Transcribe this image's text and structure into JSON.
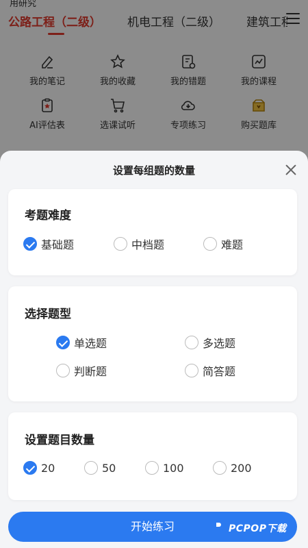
{
  "status_bar": {
    "partial_text": "用研究"
  },
  "top_tabs": [
    {
      "label": "公路工程（二级）",
      "active": true
    },
    {
      "label": "机电工程（二级）",
      "active": false
    },
    {
      "label": "建筑工程",
      "active": false
    }
  ],
  "tools": [
    {
      "label": "我的笔记",
      "icon": "pencil-note-icon"
    },
    {
      "label": "我的收藏",
      "icon": "star-icon"
    },
    {
      "label": "我的错题",
      "icon": "wrong-questions-icon"
    },
    {
      "label": "我的课程",
      "icon": "course-chart-icon"
    },
    {
      "label": "AI评估表",
      "icon": "clipboard-icon"
    },
    {
      "label": "选课试听",
      "icon": "cart-icon"
    },
    {
      "label": "专项练习",
      "icon": "cloud-download-icon"
    },
    {
      "label": "购买题库",
      "icon": "gift-box-icon"
    }
  ],
  "sheet": {
    "title": "设置每组题的数量",
    "difficulty": {
      "title": "考题难度",
      "options": [
        {
          "label": "基础题",
          "checked": true
        },
        {
          "label": "中档题",
          "checked": false
        },
        {
          "label": "难题",
          "checked": false
        }
      ]
    },
    "question_type": {
      "title": "选择题型",
      "options": [
        {
          "label": "单选题",
          "checked": true
        },
        {
          "label": "多选题",
          "checked": false
        },
        {
          "label": "判断题",
          "checked": false
        },
        {
          "label": "简答题",
          "checked": false
        }
      ]
    },
    "count": {
      "title": "设置题目数量",
      "options": [
        {
          "label": "20",
          "checked": true
        },
        {
          "label": "50",
          "checked": false
        },
        {
          "label": "100",
          "checked": false
        },
        {
          "label": "200",
          "checked": false
        }
      ]
    },
    "start_button": "开始练习"
  },
  "watermark": {
    "text": "PCPOP下载"
  },
  "colors": {
    "accent_blue": "#2b7af0",
    "active_tab_red": "#e33b2f"
  }
}
